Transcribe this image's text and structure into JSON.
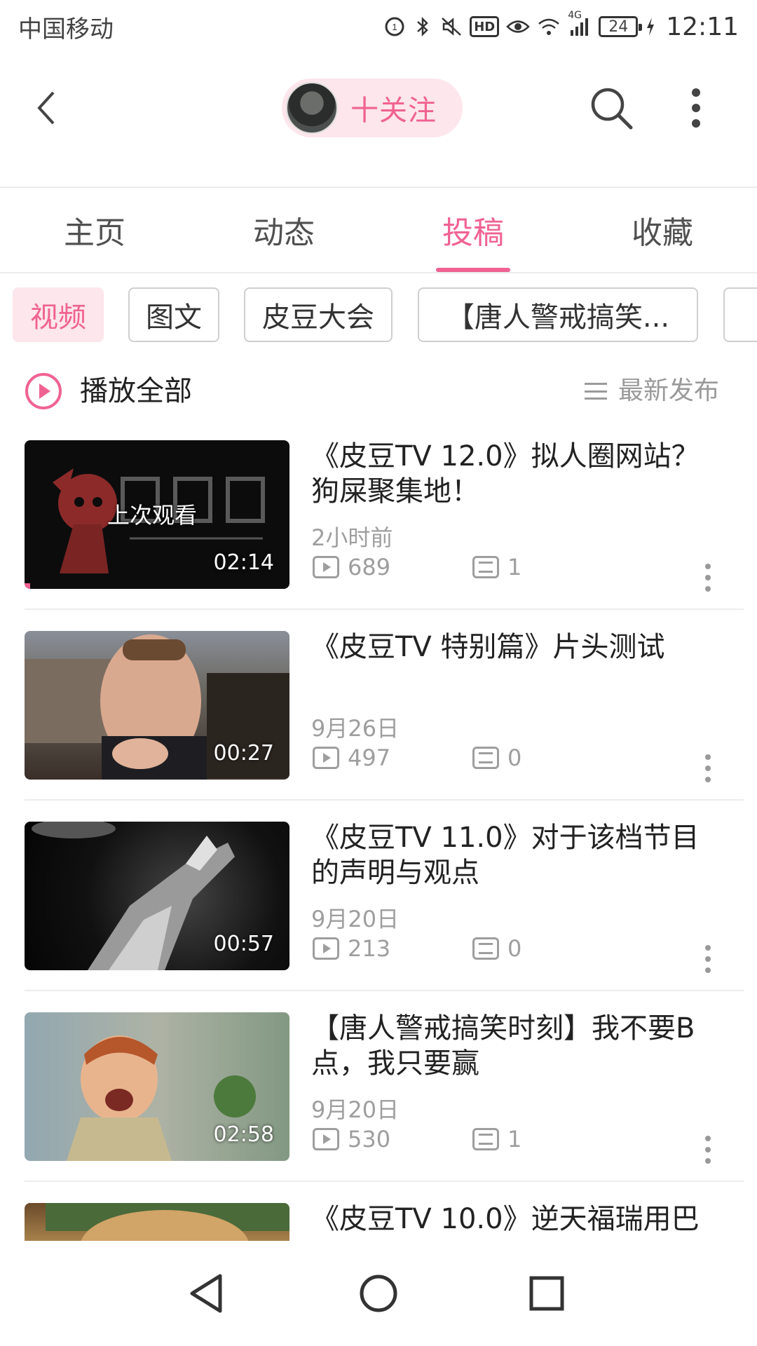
{
  "status_bar": {
    "carrier": "中国移动",
    "network": "4G",
    "hd": "HD",
    "battery": "24",
    "time": "12:11"
  },
  "header": {
    "follow_label": "十关注"
  },
  "tabs": [
    {
      "label": "主页",
      "active": false
    },
    {
      "label": "动态",
      "active": false
    },
    {
      "label": "投稿",
      "active": true
    },
    {
      "label": "收藏",
      "active": false
    }
  ],
  "chips": [
    {
      "label": "视频",
      "active": true
    },
    {
      "label": "图文",
      "active": false
    },
    {
      "label": "皮豆大会",
      "active": false
    },
    {
      "label": "【唐人警戒搞笑...",
      "active": false
    }
  ],
  "play_all_label": "播放全部",
  "sort_label": "最新发布",
  "videos": [
    {
      "title": "《皮豆TV 12.0》拟人圈网站？狗屎聚集地！",
      "date": "2小时前",
      "plays": "689",
      "comments": "1",
      "duration": "02:14",
      "last_watched": "上次观看"
    },
    {
      "title": "《皮豆TV 特别篇》片头测试",
      "date": "9月26日",
      "plays": "497",
      "comments": "0",
      "duration": "00:27"
    },
    {
      "title": "《皮豆TV 11.0》对于该档节目的声明与观点",
      "date": "9月20日",
      "plays": "213",
      "comments": "0",
      "duration": "00:57"
    },
    {
      "title": "【唐人警戒搞笑时刻】我不要B点，我只要赢",
      "date": "9月20日",
      "plays": "530",
      "comments": "1",
      "duration": "02:58"
    },
    {
      "title": "《皮豆TV 10.0》逆天福瑞用巴"
    }
  ],
  "colors": {
    "accent": "#f06292",
    "accent_bg": "#fde6ec",
    "muted": "#9e9e9e"
  }
}
